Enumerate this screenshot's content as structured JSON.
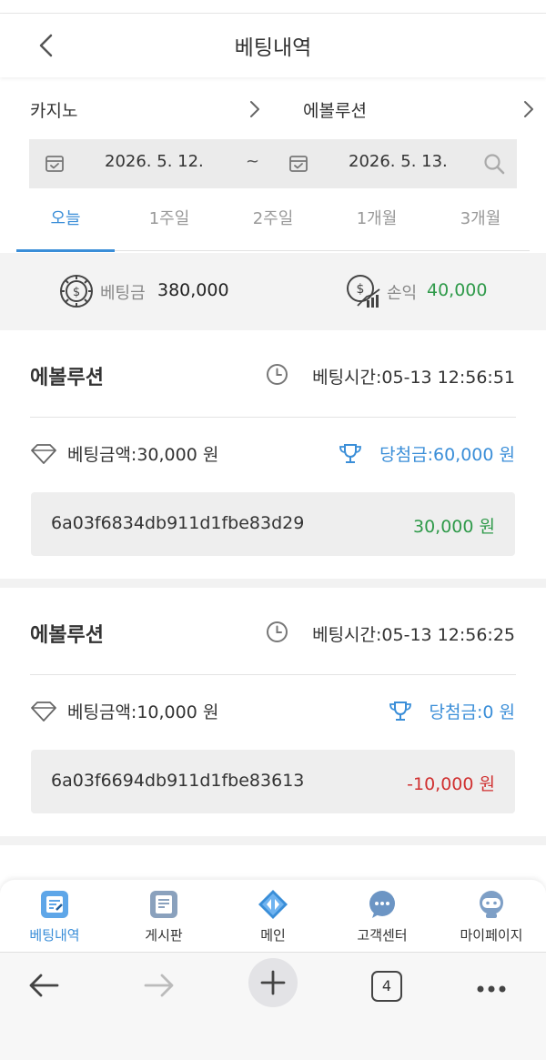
{
  "header": {
    "title": "베팅내역"
  },
  "category": {
    "left": "카지노",
    "right": "에볼루션"
  },
  "date_range": {
    "start": "2026. 5. 12.",
    "separator": "~",
    "end": "2026. 5. 13."
  },
  "period_tabs": [
    {
      "label": "오늘",
      "active": true
    },
    {
      "label": "1주일",
      "active": false
    },
    {
      "label": "2주일",
      "active": false
    },
    {
      "label": "1개월",
      "active": false
    },
    {
      "label": "3개월",
      "active": false
    }
  ],
  "summary": {
    "bet_label": "베팅금",
    "bet_value": "380,000",
    "profit_label": "손익",
    "profit_value": "40,000",
    "profit_color": "#2f9a4a"
  },
  "bets": [
    {
      "game": "에볼루션",
      "time": "베팅시간:05-13 12:56:51",
      "amount": "베팅금액:30,000 원",
      "win": "당첨금:60,000 원",
      "tx_id": "6a03f6834db911d1fbe83d29",
      "result": "30,000 원",
      "result_color": "#2f9a4a"
    },
    {
      "game": "에볼루션",
      "time": "베팅시간:05-13 12:56:25",
      "amount": "베팅금액:10,000 원",
      "win": "당첨금:0 원",
      "tx_id": "6a03f6694db911d1fbe83613",
      "result": "-10,000 원",
      "result_color": "#d03030"
    }
  ],
  "bottom_nav": [
    {
      "label": "베팅내역",
      "icon": "betting-history-icon",
      "active": true
    },
    {
      "label": "게시판",
      "icon": "board-icon",
      "active": false
    },
    {
      "label": "메인",
      "icon": "main-icon",
      "active": false
    },
    {
      "label": "고객센터",
      "icon": "chat-icon",
      "active": false
    },
    {
      "label": "마이페이지",
      "icon": "profile-icon",
      "active": false
    }
  ],
  "browser": {
    "tab_count": "4"
  },
  "colors": {
    "accent": "#3a8ed8",
    "positive": "#2f9a4a",
    "negative": "#d03030"
  }
}
